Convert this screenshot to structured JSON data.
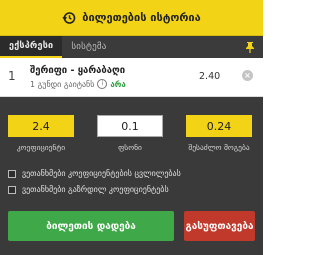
{
  "header": {
    "title": "ბილეთების ისტორია"
  },
  "tabs": [
    {
      "label": "ექსპრესი",
      "active": true
    },
    {
      "label": "სისტემა",
      "active": false
    }
  ],
  "bet": {
    "index": "1",
    "match": "შერიფი - ყარაბაღი",
    "market": "1 გუნდი გაიტანს",
    "selection": "არა",
    "odd": "2.40"
  },
  "summary": {
    "total_odd": "2.4",
    "stake": "0.1",
    "potential_win": "0.24",
    "total_odd_label": "კოეფიციენტი",
    "stake_label": "ფსონი",
    "potential_win_label": "შესაძლო მოგება"
  },
  "options": [
    "ვეთანხმები კოეფიციენტების ცვლილებას",
    "ვეთანხმები გაზრდილ კოეფიციენტებს"
  ],
  "buttons": {
    "place": "ბილეთის დადება",
    "clear": "გასუფთავება"
  },
  "colors": {
    "accent": "#f2d316",
    "tabbar": "#3b3b3b",
    "panel": "#3a3a3a",
    "place": "#3fa848",
    "clear": "#c0392b"
  }
}
